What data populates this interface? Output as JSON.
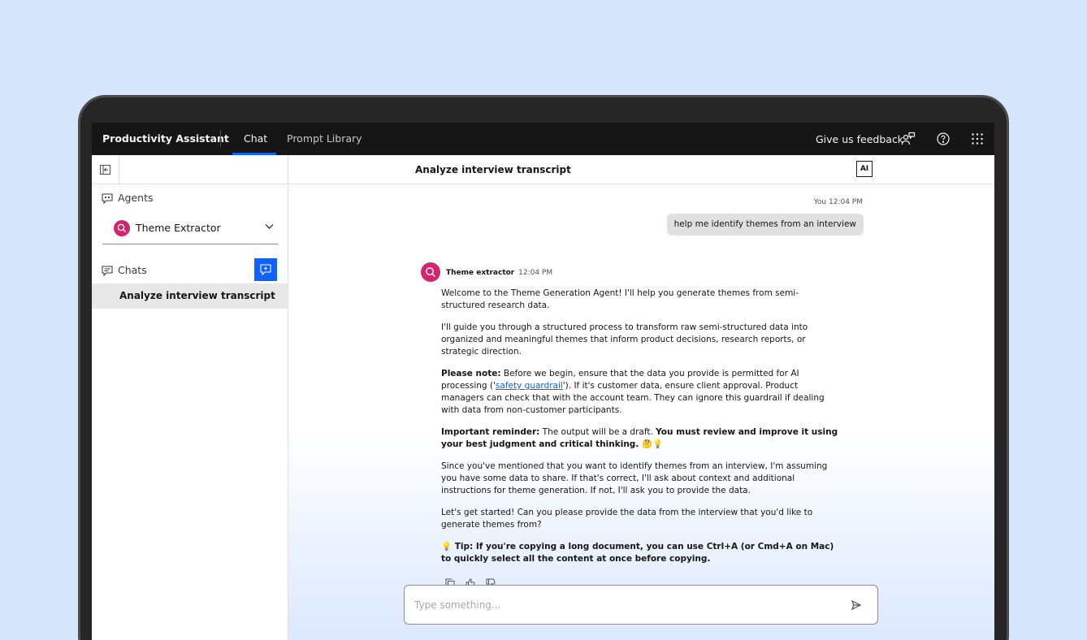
{
  "header": {
    "brand": "Productivity Assistant",
    "tabs": [
      {
        "label": "Chat",
        "active": true
      },
      {
        "label": "Prompt Library",
        "active": false
      }
    ],
    "feedback_label": "Give us feedback",
    "icons": [
      "feedback-icon",
      "help-icon",
      "app-switcher-icon"
    ]
  },
  "sidebar": {
    "agents_label": "Agents",
    "selected_agent": "Theme Extractor",
    "chats_label": "Chats",
    "chats": [
      {
        "title": "Analyze interview transcript",
        "active": true
      }
    ]
  },
  "main": {
    "title": "Analyze interview transcript",
    "ai_badge": "AI",
    "user_message": {
      "sender": "You",
      "time": "12:04 PM",
      "text": "help me identify themes from an interview"
    },
    "bot_message": {
      "sender": "Theme extractor",
      "time": "12:04 PM",
      "p1": "Welcome to the Theme Generation Agent! I'll help you generate themes from semi-structured research data.",
      "p2": "I'll guide you through a structured process to transform raw semi-structured data into organized and meaningful themes that inform product decisions, research reports, or strategic direction.",
      "p3_bold": "Please note:",
      "p3_a": " Before we begin, ensure that the data you provide is permitted for AI processing ('",
      "p3_link": "safety guardrail",
      "p3_b": "'). If it's customer data, ensure client approval. Product managers can check that with the account team. They can ignore this guardrail if dealing with data from non-customer participants.",
      "p4_bold": "Important reminder:",
      "p4_a": " The output will be a draft. ",
      "p4_bold2": "You must review and improve it using your best judgment and critical thinking. 🤔💡",
      "p5": "Since you've mentioned that you want to identify themes from an interview, I'm assuming you have some data to share. If that's correct, I'll ask about context and additional instructions for theme generation. If not, I'll ask you to provide the data.",
      "p6": "Let's get started! Can you please provide the data from the interview that you'd like to generate themes from?",
      "p7_bold": "💡 Tip: If you're copying a long document, you can use Ctrl+A (or Cmd+A on Mac) to quickly select all the content at once before copying."
    },
    "input_placeholder": "Type something..."
  }
}
